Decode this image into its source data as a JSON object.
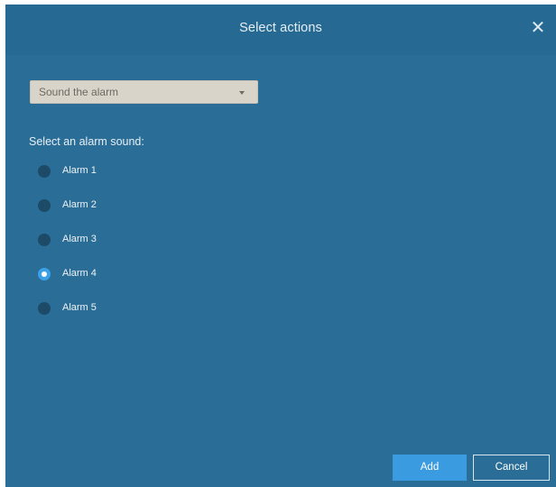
{
  "dialog": {
    "title": "Select actions",
    "close_icon": "close-icon"
  },
  "action_select": {
    "value": "Sound the alarm",
    "icon": "chevron-down-icon"
  },
  "alarm_sound": {
    "prompt": "Select an alarm sound:",
    "options": [
      {
        "label": "Alarm 1",
        "checked": false
      },
      {
        "label": "Alarm 2",
        "checked": false
      },
      {
        "label": "Alarm 3",
        "checked": false
      },
      {
        "label": "Alarm 4",
        "checked": true
      },
      {
        "label": "Alarm 5",
        "checked": false
      }
    ]
  },
  "buttons": {
    "add_label": "Add",
    "cancel_label": "Cancel"
  },
  "colors": {
    "dialog_background": "#2a6e98",
    "select_background": "#d9d4c9",
    "accent": "#3b9be0",
    "radio_unchecked": "#1d4a66"
  }
}
